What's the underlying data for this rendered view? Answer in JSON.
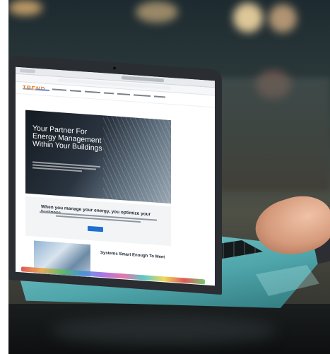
{
  "scene": {
    "site": {
      "logo_text": "TREND",
      "accent_color": "#e8701e",
      "cta_color": "#1f6fd1"
    },
    "hero": {
      "title": "Your Partner For Energy Management Within Your Buildings"
    },
    "section": {
      "title": "When you manage your energy, you optimize your business"
    },
    "article": {
      "title": "Systems Smart Enough To Meet"
    }
  }
}
